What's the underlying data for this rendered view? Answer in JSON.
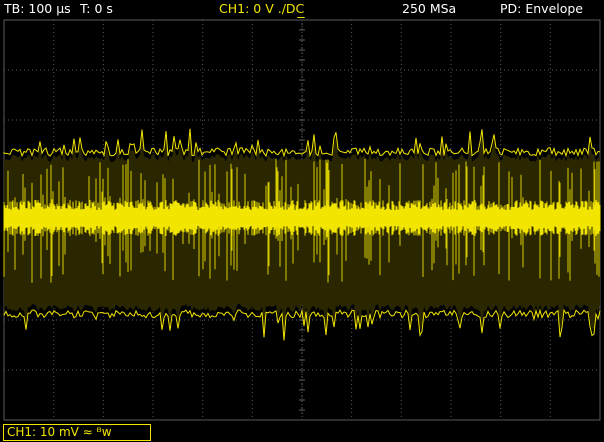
{
  "header": {
    "timebase": "TB: 100 µs",
    "trigger_time": "T: 0 s",
    "channel_setting": "CH1: 0 V ./DC",
    "sample_rate": "250 MSa",
    "acquire_mode": "PD: Envelope"
  },
  "footer": {
    "channel_scale": "CH1: 10 mV ≈ ᴮw"
  },
  "colors": {
    "trace": "#f2e600",
    "grid": "#5a5a5a",
    "background": "#000000"
  }
}
